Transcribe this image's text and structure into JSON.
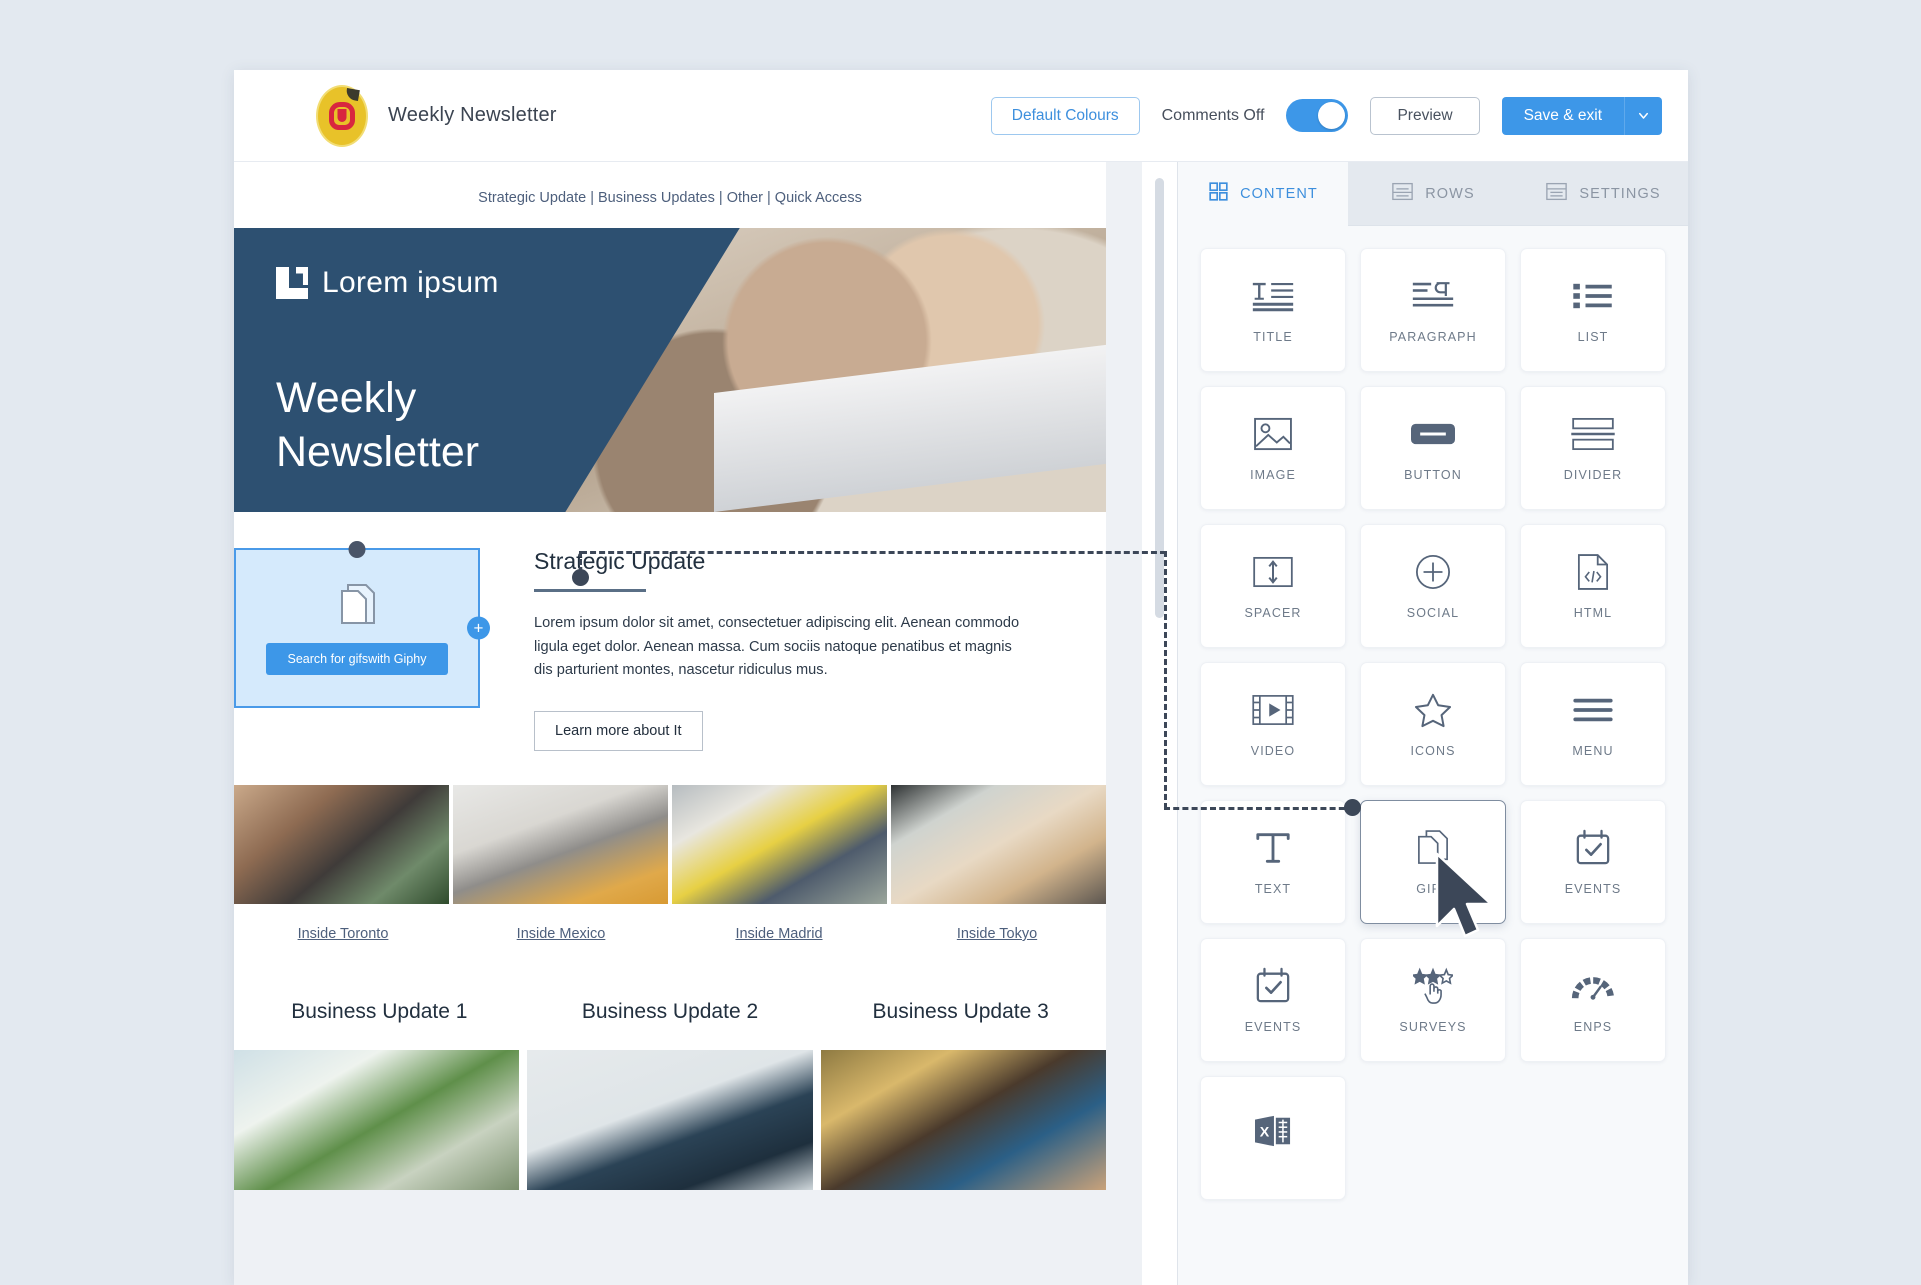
{
  "topbar": {
    "logo_icon": "company-logo-icon",
    "document_title": "Weekly Newsletter",
    "default_colours_label": "Default Colours",
    "comments_label": "Comments Off",
    "comments_toggle_state": "on",
    "preview_label": "Preview",
    "save_label": "Save & exit",
    "save_caret_icon": "chevron-down-icon",
    "accent_color": "#3d97e8"
  },
  "panel": {
    "tabs": [
      {
        "label": "CONTENT",
        "icon": "grid-icon",
        "active": true
      },
      {
        "label": "ROWS",
        "icon": "rows-icon",
        "active": false
      },
      {
        "label": "SETTINGS",
        "icon": "settings-panel-icon",
        "active": false
      }
    ],
    "tiles": [
      {
        "label": "TITLE",
        "icon": "title-icon",
        "selected": false
      },
      {
        "label": "PARAGRAPH",
        "icon": "paragraph-icon",
        "selected": false
      },
      {
        "label": "LIST",
        "icon": "list-icon",
        "selected": false
      },
      {
        "label": "IMAGE",
        "icon": "image-icon",
        "selected": false
      },
      {
        "label": "BUTTON",
        "icon": "button-icon",
        "selected": false
      },
      {
        "label": "DIVIDER",
        "icon": "divider-icon",
        "selected": false
      },
      {
        "label": "SPACER",
        "icon": "spacer-icon",
        "selected": false
      },
      {
        "label": "SOCIAL",
        "icon": "plus-circle-icon",
        "selected": false
      },
      {
        "label": "HTML",
        "icon": "html-code-icon",
        "selected": false
      },
      {
        "label": "VIDEO",
        "icon": "video-icon",
        "selected": false
      },
      {
        "label": "ICONS",
        "icon": "star-icon",
        "selected": false
      },
      {
        "label": "MENU",
        "icon": "hamburger-menu-icon",
        "selected": false
      },
      {
        "label": "TEXT",
        "icon": "text-t-icon",
        "selected": false
      },
      {
        "label": "GIFS",
        "icon": "gif-document-icon",
        "selected": true
      },
      {
        "label": "EVENTS",
        "icon": "calendar-check-icon",
        "selected": false
      },
      {
        "label": "EVENTS",
        "icon": "calendar-check-icon",
        "selected": false
      },
      {
        "label": "SURVEYS",
        "icon": "stars-hand-icon",
        "selected": false
      },
      {
        "label": "ENPS",
        "icon": "gauge-icon",
        "selected": false
      },
      {
        "label": "",
        "icon": "excel-icon",
        "selected": false
      }
    ]
  },
  "email": {
    "nav_links": [
      "Strategic Update",
      "Business Updates",
      "Other",
      "Quick Access"
    ],
    "nav_separator": " | ",
    "hero": {
      "logo_text": "Lorem ipsum",
      "logo_icon": "lorem-bracket-icon",
      "title_line1": "Weekly",
      "title_line2": "Newsletter"
    },
    "gif_block": {
      "icon": "gif-document-icon",
      "search_button_label": "Search for gifswith Giphy",
      "add_handle_icon": "plus-icon"
    },
    "article": {
      "title": "Strategic Update",
      "body": "Lorem ipsum dolor sit amet, consectetuer adipiscing elit. Aenean commodo ligula eget dolor. Aenean massa. Cum sociis natoque penatibus et magnis dis parturient montes, nascetur ridiculus mus.",
      "cta_label": "Learn more about It"
    },
    "city_links": [
      "Inside Toronto",
      "Inside Mexico",
      "Inside Madrid",
      "Inside Tokyo"
    ],
    "business_updates": [
      "Business Update 1",
      "Business Update 2",
      "Business Update 3"
    ]
  }
}
